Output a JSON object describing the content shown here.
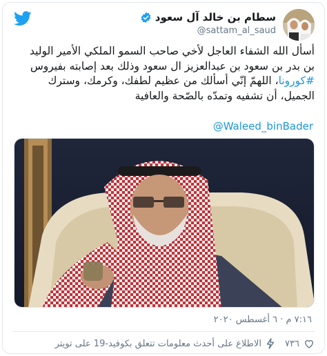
{
  "tweet": {
    "author": {
      "display_name": "سطام بن خالد آل سعود",
      "handle": "@sattam_al_saud",
      "verified": true
    },
    "text_lines": [
      "أسأل الله الشفاء العاجل لأخي صاحب السمو الملكي الأمير الوليد",
      "بن بدر بن سعود بن عبدالعزيز ال سعود وذلك بعد إصابته بفيروس",
      "، اللهمّ إنّي أسألك من عظيم لطفك، وكرمك، وسترك",
      "الجميل، أن تشفيه وتمدّه بالصّحة والعافية"
    ],
    "hashtag": "#كورونا",
    "mention": "@Waleed_binBader",
    "timestamp": "٧:١٦ م · ٦ أغسطس ٢٠٢٠",
    "likes": "٧٣٦",
    "info_link": "الاطلاع على أحدث معلومات تتعلق بكوفيد-19 على تويتر"
  },
  "icons": {
    "brand": "twitter-bird-icon",
    "verified": "verified-badge-icon",
    "like": "heart-icon",
    "info": "lightning-bolt-icon"
  },
  "colors": {
    "twitter_blue": "#1da1f2",
    "link_blue": "#1b95e0",
    "secondary_text": "#657786",
    "border": "#e1e8ed"
  }
}
